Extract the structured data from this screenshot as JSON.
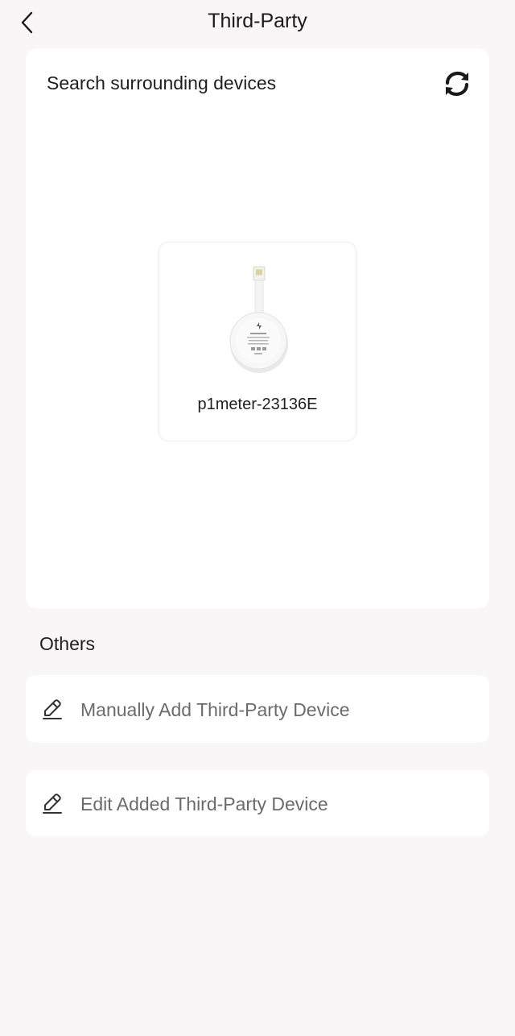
{
  "header": {
    "title": "Third-Party",
    "back_icon": "chevron-left-icon"
  },
  "search": {
    "title": "Search surrounding devices",
    "refresh_icon": "refresh-icon"
  },
  "devices": [
    {
      "name": "p1meter-23136E",
      "image": "p1-meter-dongle"
    }
  ],
  "others": {
    "heading": "Others",
    "items": [
      {
        "label": "Manually Add Third-Party Device",
        "icon": "pencil-icon"
      },
      {
        "label": "Edit Added Third-Party Device",
        "icon": "pencil-icon"
      }
    ]
  },
  "colors": {
    "background": "#f8f6f6",
    "card": "#ffffff",
    "text_primary": "#1f1f1f",
    "text_secondary": "#6b6b6b"
  }
}
